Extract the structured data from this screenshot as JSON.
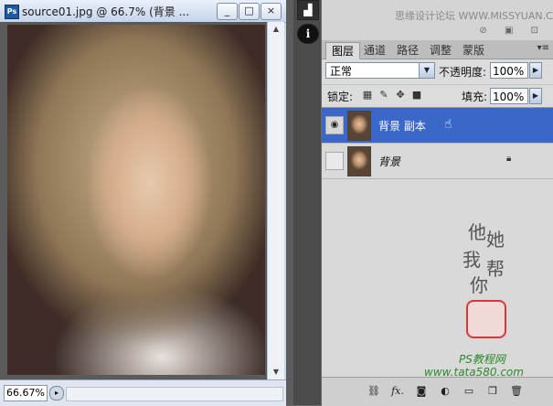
{
  "document": {
    "title": "source01.jpg @ 66.7% (背景 ...",
    "app_badge": "Ps",
    "zoom": "66.67%",
    "window_buttons": [
      "_",
      "□",
      "×"
    ]
  },
  "dock": {
    "icons": [
      "histogram-icon",
      "info-icon"
    ],
    "info_label": "i"
  },
  "panel": {
    "watermark": "思缘设计论坛 WWW.MISSYUAN.COM",
    "tabs": [
      "图层",
      "通道",
      "路径",
      "调整",
      "蒙版"
    ],
    "active_tab": "图层",
    "blend_mode": "正常",
    "opacity_label": "不透明度:",
    "opacity_value": "100%",
    "lock_label": "锁定:",
    "fill_label": "填充:",
    "fill_value": "100%",
    "layers": [
      {
        "name": "背景 副本",
        "visible": true,
        "selected": true
      },
      {
        "name": "背景",
        "visible": false,
        "selected": false,
        "locked": true
      }
    ],
    "signature_chars": [
      "他",
      "她",
      "我",
      "帮",
      "你"
    ],
    "site_name": "PS教程网",
    "site_url": "www.tata580.com"
  },
  "colors": {
    "selection": "#3a67c8",
    "panel_bg": "#dcdcdc",
    "dock_bg": "#4b4b4b"
  }
}
